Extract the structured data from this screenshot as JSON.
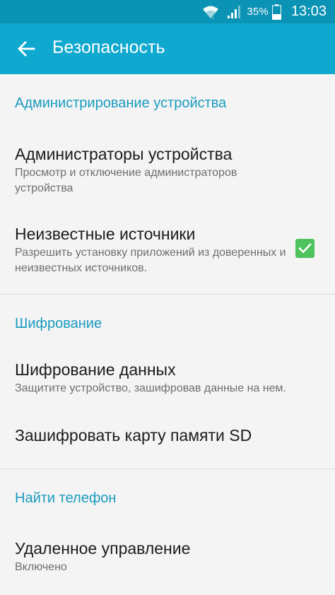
{
  "status_bar": {
    "wifi_icon": "wifi-icon",
    "signal_icon": "signal-icon",
    "battery_percent": "35%",
    "battery_icon": "battery-icon",
    "time": "13:03"
  },
  "app_bar": {
    "back_icon": "arrow-back-icon",
    "title": "Безопасность"
  },
  "sections": {
    "device_admin": {
      "header": "Администрирование устройства",
      "items": [
        {
          "title": "Администраторы устройства",
          "subtitle": "Просмотр и отключение администраторов устройства"
        },
        {
          "title": "Неизвестные источники",
          "subtitle": "Разрешить установку приложений из доверенных и неизвестных источников.",
          "checked": true
        }
      ]
    },
    "encryption": {
      "header": "Шифрование",
      "items": [
        {
          "title": "Шифрование данных",
          "subtitle": "Защитите устройство, зашифровав данные на нем."
        },
        {
          "title": "Зашифровать карту памяти SD"
        }
      ]
    },
    "find_phone": {
      "header": "Найти телефон",
      "items": [
        {
          "title": "Удаленное управление",
          "subtitle": "Включено"
        }
      ]
    }
  },
  "colors": {
    "status_bar": "#0a93b4",
    "app_bar": "#0fa8cf",
    "section_header": "#1a9bbf",
    "checkbox": "#4ec25c",
    "background": "#f4f4f4"
  }
}
